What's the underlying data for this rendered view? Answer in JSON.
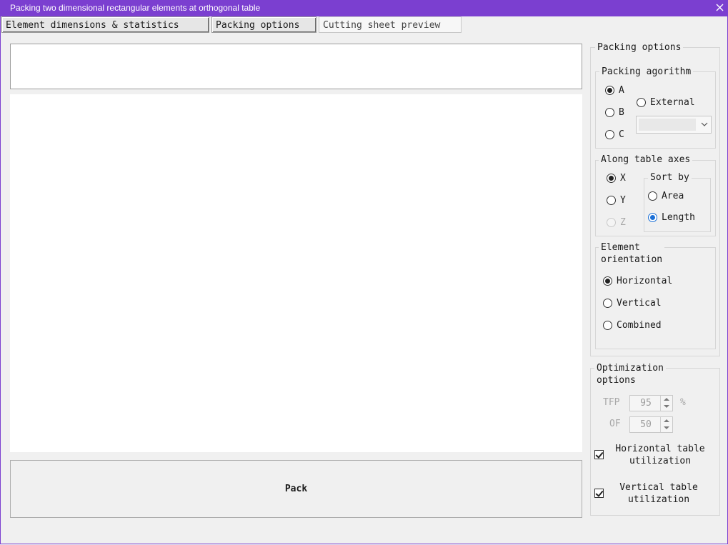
{
  "window": {
    "title": "Packing two dimensional rectangular elements at orthogonal table",
    "close_icon": "close-icon"
  },
  "tabs": [
    {
      "label": "Element dimensions & statistics"
    },
    {
      "label": "Packing options"
    },
    {
      "label": "Cutting sheet preview"
    }
  ],
  "packing_options": {
    "title": "Packing options",
    "algorithm": {
      "title": "Packing agorithm",
      "options": [
        "A",
        "B",
        "C"
      ],
      "selected": "A",
      "external_label": "External",
      "external_value": ""
    },
    "axes": {
      "title": "Along table axes",
      "options": [
        "X",
        "Y",
        "Z"
      ],
      "selected": "X",
      "sort_by": {
        "title": "Sort by",
        "options": [
          "Area",
          "Length"
        ],
        "selected": "Length"
      }
    },
    "orientation": {
      "title_line1": "Element",
      "title_line2": "orientation",
      "options": [
        "Horizontal",
        "Vertical",
        "Combined"
      ],
      "selected": "Horizontal"
    }
  },
  "optimization": {
    "title_line1": "Optimization",
    "title_line2": "options",
    "tfp_label": "TFP",
    "tfp_value": "95",
    "tfp_unit": "%",
    "of_label": "OF",
    "of_value": "50",
    "horizontal_line1": "Horizontal table",
    "horizontal_line2": "utilization",
    "horizontal_checked": true,
    "vertical_line1": "Vertical table",
    "vertical_line2": "utilization",
    "vertical_checked": true
  },
  "main": {
    "pack_button": "Pack"
  }
}
